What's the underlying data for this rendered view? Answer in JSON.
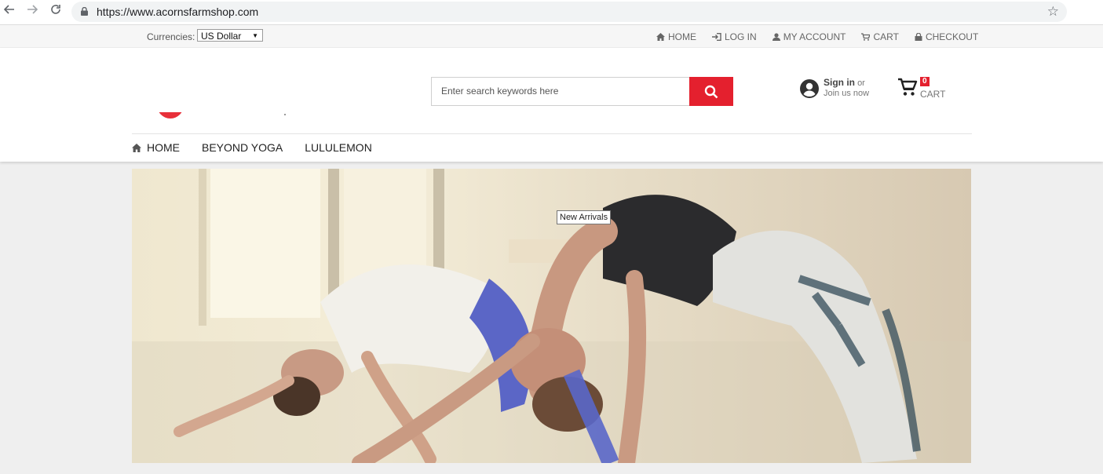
{
  "browser": {
    "url": "https://www.acornsfarmshop.com"
  },
  "topbar": {
    "currency_label": "Currencies:",
    "currency_value": "US Dollar",
    "links": [
      {
        "label": "HOME",
        "icon": "home-icon"
      },
      {
        "label": "LOG IN",
        "icon": "login-icon"
      },
      {
        "label": "MY ACCOUNT",
        "icon": "user-icon"
      },
      {
        "label": "CART",
        "icon": "cart-icon"
      },
      {
        "label": "CHECKOUT",
        "icon": "lock-icon"
      }
    ]
  },
  "header": {
    "search_placeholder": "Enter search keywords here",
    "account": {
      "sign_in": "Sign in",
      "or": "or",
      "join": "Join us now"
    },
    "cart": {
      "count": "0",
      "label": "CART"
    }
  },
  "nav": {
    "items": [
      "HOME",
      "BEYOND YOGA",
      "LULULEMON"
    ]
  },
  "hero": {
    "tooltip": "New Arrivals"
  },
  "colors": {
    "accent": "#e4202e",
    "topbar_bg": "#f6f6f6",
    "page_bg": "#efefef"
  }
}
